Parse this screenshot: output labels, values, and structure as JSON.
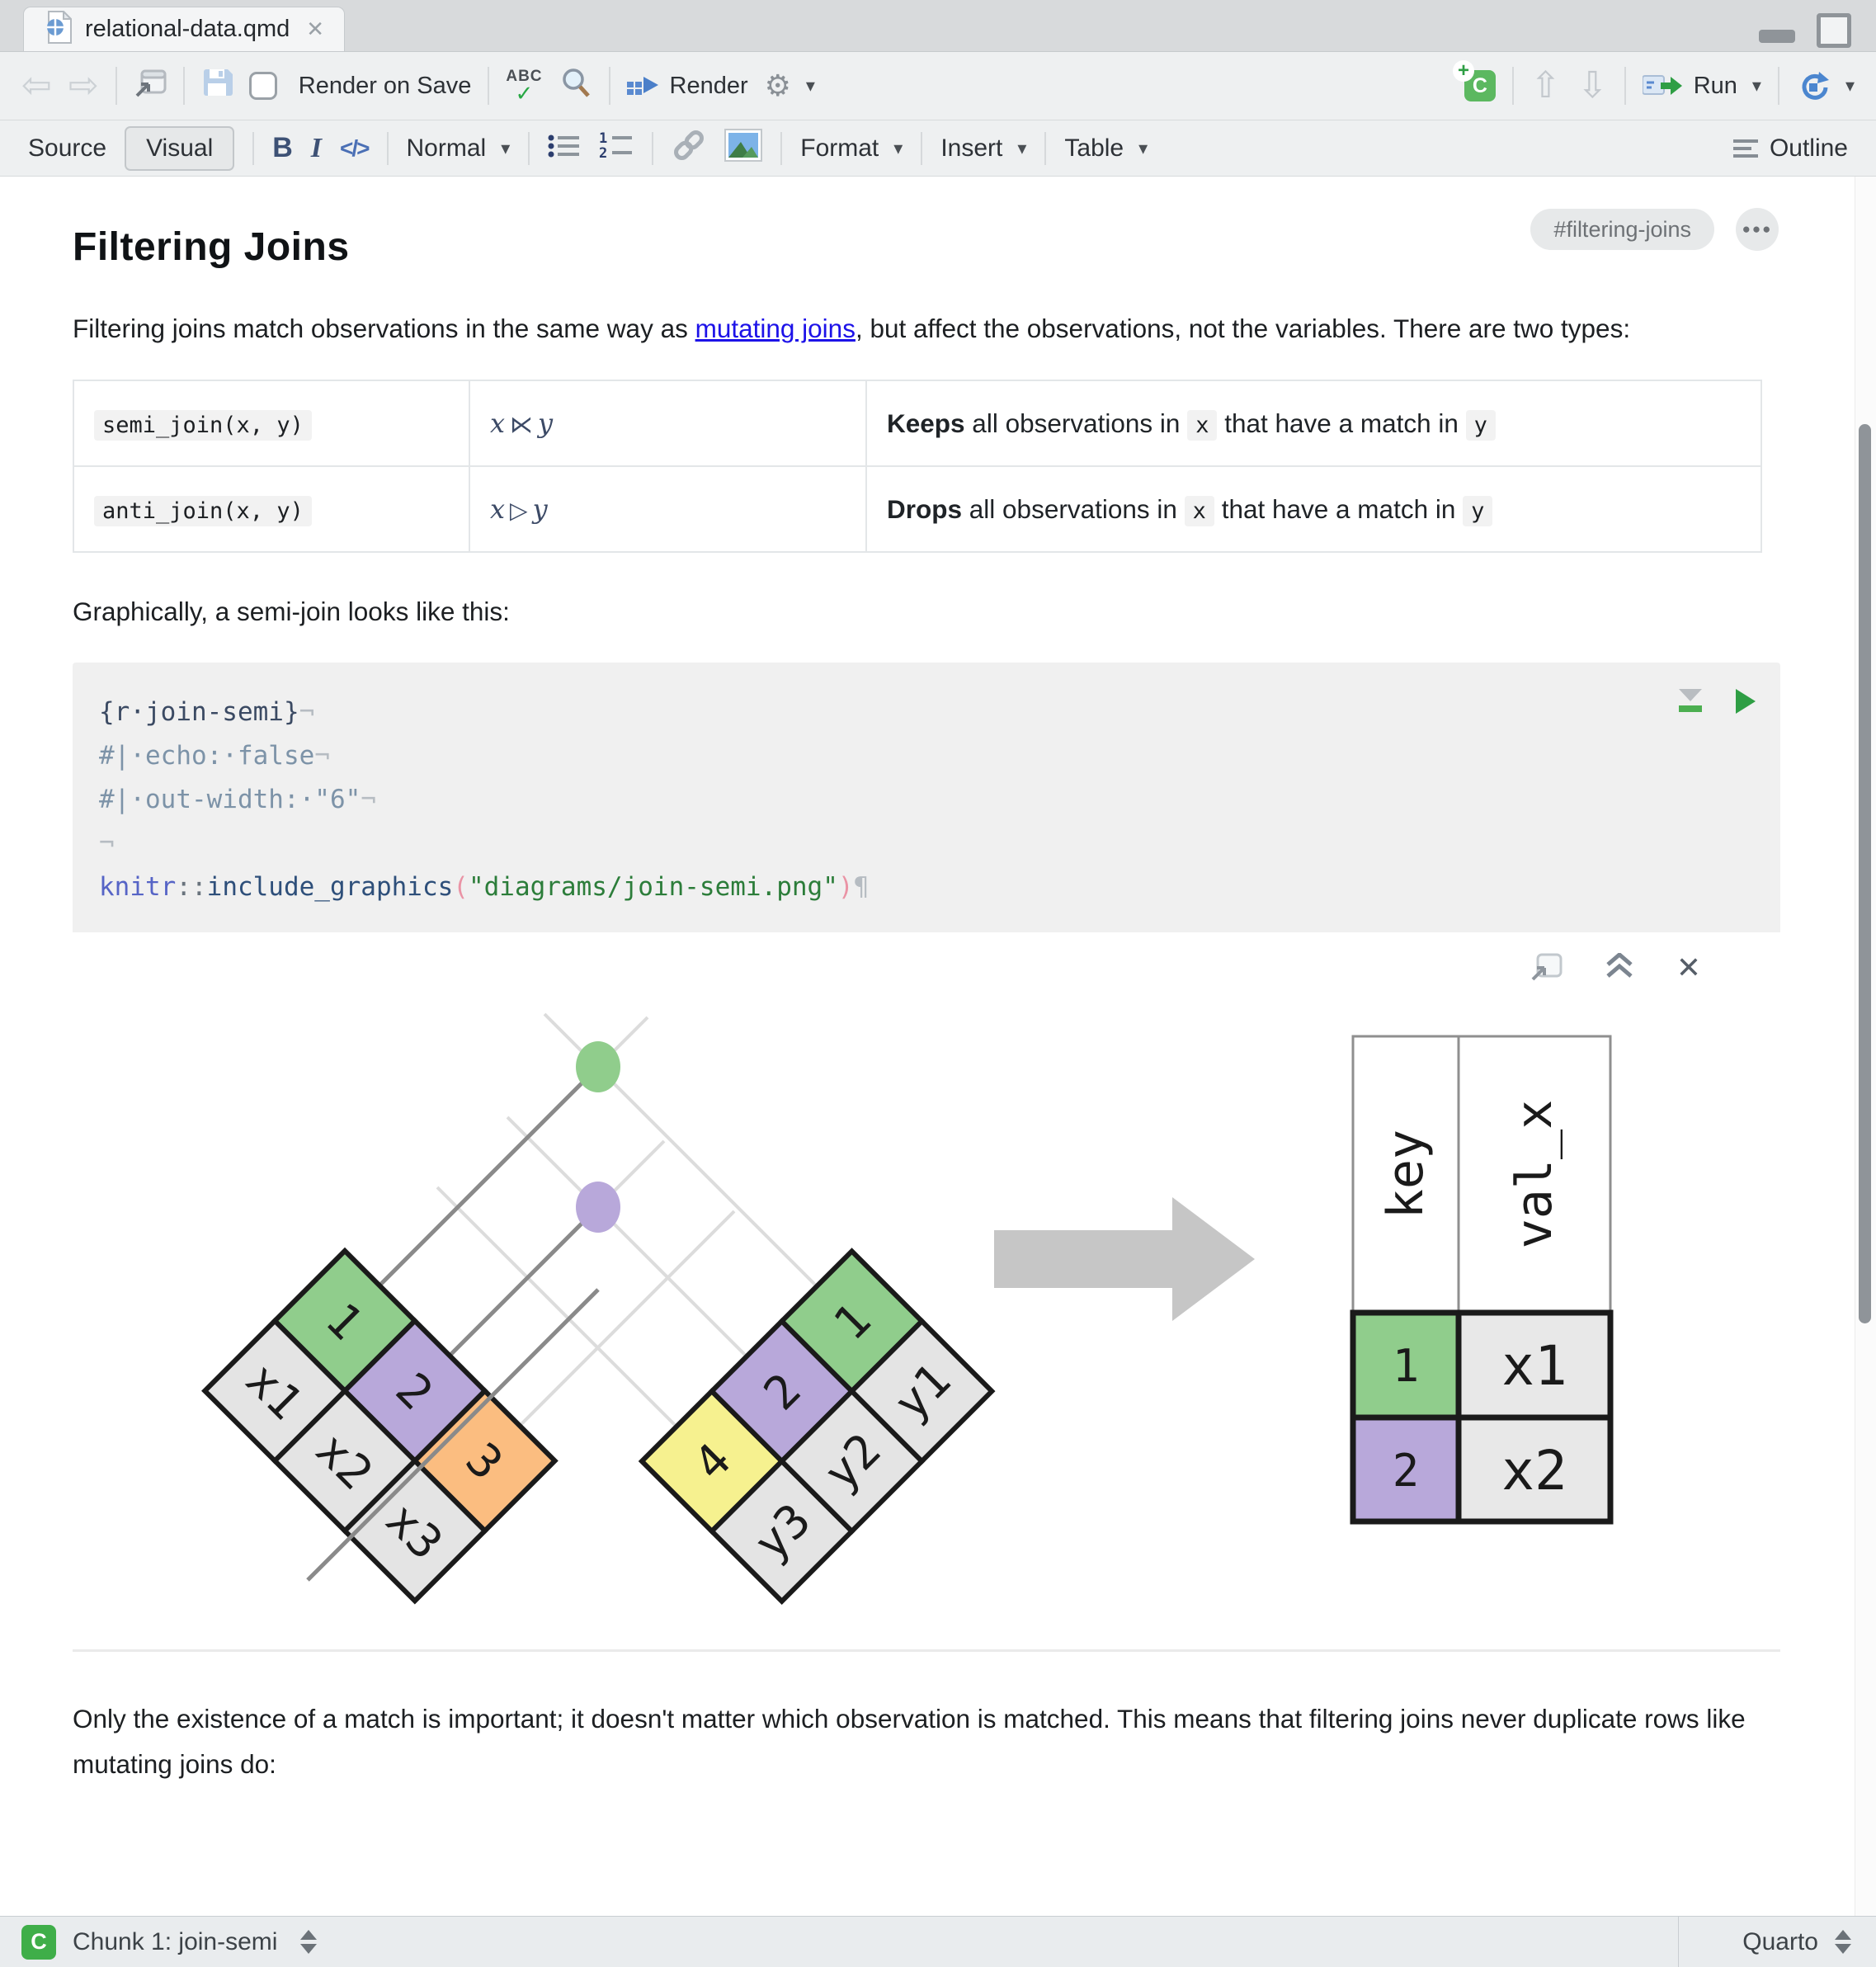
{
  "tab": {
    "title": "relational-data.qmd",
    "close": "✕"
  },
  "toolbar": {
    "render_on_save": "Render on Save",
    "render": "Render",
    "run": "Run"
  },
  "format_bar": {
    "source": "Source",
    "visual": "Visual",
    "bold": "B",
    "italic": "I",
    "code": "</>",
    "paragraph_style": "Normal",
    "format": "Format",
    "insert": "Insert",
    "table": "Table",
    "outline": "Outline"
  },
  "document": {
    "heading": "Filtering Joins",
    "anchor": "#filtering-joins",
    "dots": "●●●",
    "para1": {
      "pre": "Filtering joins match observations in the same way as ",
      "link": "mutating joins",
      "post": ", but affect the observations, not the variables. There are two types:"
    },
    "join_table": {
      "rows": [
        {
          "code": "semi_join(x, y)",
          "mx": "x",
          "op": "⋉",
          "my": "y",
          "verb": "Keeps",
          "pre": " all observations in ",
          "cx": "x",
          "mid": " that have a match in ",
          "cy": "y"
        },
        {
          "code": "anti_join(x, y)",
          "mx": "x",
          "op": "▷",
          "my": "y",
          "verb": "Drops",
          "pre": " all observations in ",
          "cx": "x",
          "mid": " that have a match in ",
          "cy": "y"
        }
      ]
    },
    "para2": "Graphically, a semi-join looks like this:",
    "para3": "Only the existence of a match is important; it doesn't matter which observation is matched. This means that filtering joins never duplicate rows like mutating joins do:"
  },
  "chunk": {
    "header": "{r·join-semi}",
    "mark": "¬",
    "comment1": "#|·echo:·false",
    "comment2": "#|·out-width:·\"6\"",
    "call": {
      "ns": "knitr",
      "colons": "::",
      "fn": "include_graphics",
      "open": "(",
      "str": "\"diagrams/join-semi.png\"",
      "close": ")",
      "pilcrow": "¶"
    }
  },
  "diagram": {
    "left": {
      "keys": [
        "1",
        "2",
        "3"
      ],
      "vals": [
        "x1",
        "x2",
        "x3"
      ],
      "key_colors": [
        "#90cd8c",
        "#b8a8da",
        "#fbbd80"
      ],
      "val_color": "#e4e4e4"
    },
    "right": {
      "keys": [
        "4",
        "2",
        "1"
      ],
      "vals": [
        "y3",
        "y2",
        "y1"
      ],
      "key_colors": [
        "#f6f18f",
        "#b8a8da",
        "#90cd8c"
      ]
    },
    "dots": [
      "#90cd8c",
      "#b8a8da"
    ],
    "result": {
      "headers": [
        "key",
        "val_x"
      ],
      "rows": [
        {
          "key": "1",
          "val": "x1",
          "color": "#90cd8c"
        },
        {
          "key": "2",
          "val": "x2",
          "color": "#b8a8da"
        }
      ],
      "val_color": "#e8e8e8"
    }
  },
  "status": {
    "chunk_label": "Chunk 1: join-semi",
    "language": "Quarto"
  },
  "colors": {
    "run_green": "#2e9e44",
    "render_blue": "#4b7fc9",
    "link_blue": "#1d12e8",
    "code_header": "#3b4a63",
    "code_comment": "#7d93a8",
    "code_namespace": "#5664c6",
    "code_function": "#2e4f7a",
    "code_paren": "#ea93a5",
    "code_string": "#2c7d3a",
    "chunk_badge_green": "#3fae49"
  }
}
